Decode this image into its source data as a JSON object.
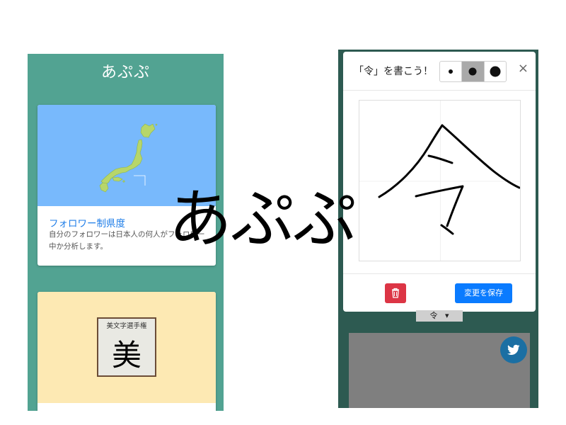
{
  "left_app": {
    "title": "あぷぷ",
    "cards": [
      {
        "title": "フォロワー制県度",
        "description": "自分のフォロワーは日本人の何人がフォロワー中か分析します。"
      },
      {
        "award_caption": "美文字選手権",
        "award_glyph": "美"
      }
    ]
  },
  "right_app": {
    "modal": {
      "title": "「令」を書こう！",
      "brush_sizes": [
        "small",
        "medium",
        "large"
      ],
      "selected_brush": "medium",
      "close_label": "×",
      "save_label": "変更を保存",
      "delete_icon": "trash-icon"
    },
    "kanji_select": {
      "value": "令"
    },
    "share_icon": "twitter-icon"
  },
  "overlay": {
    "logo_text": "あぷぷ"
  },
  "colors": {
    "left_background": "#52a392",
    "right_background": "#2d5a51",
    "map_sky": "#78b9fc",
    "award_background": "#fde9b3",
    "link_blue": "#1e7de8",
    "delete_red": "#dc3545",
    "save_blue": "#0a7bff",
    "twitter_blue": "#1b6fa3"
  }
}
